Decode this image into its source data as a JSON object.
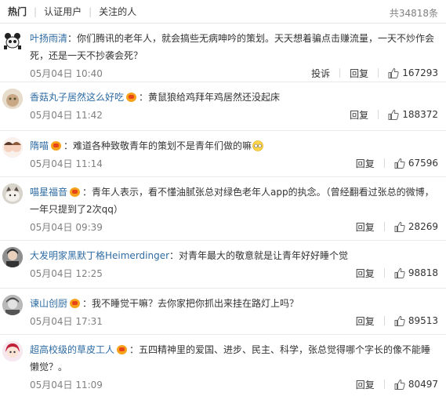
{
  "tabs": {
    "hot": "热门",
    "verified": "认证用户",
    "following": "关注的人",
    "total": "共34818条"
  },
  "comments": [
    {
      "user": "叶扬雨清",
      "vip": false,
      "text": "：你们腾讯的老年人，就会搞些无病呻吟的策划。天天想着骗点击赚流量，一天不炒作会死，还是一天不抄袭会死？",
      "time": "05月04日 10:40",
      "report": "投诉",
      "reply": "回复",
      "likes": "167293"
    },
    {
      "user": "香菇丸子居然这么好吃",
      "vip": true,
      "text": "：黄鼠狼给鸡拜年鸡居然还没起床",
      "time": "05月04日 11:42",
      "reply": "回复",
      "likes": "188372"
    },
    {
      "user": "隋喵",
      "vip": true,
      "text": "：难道各种致敬青年的策划不是青年们做的嘛",
      "time": "05月04日 11:14",
      "reply": "回复",
      "likes": "67596"
    },
    {
      "user": "喵星福音",
      "vip": true,
      "text": "：青年人表示，看不懂油腻张总对绿色老年人app的执念。（曾经翻看过张总的微博，一年只提到了2次qq）",
      "time": "05月04日 09:39",
      "reply": "回复",
      "likes": "28269"
    },
    {
      "user": "大发明家黑默丁格Heimerdinger",
      "vip": false,
      "text": "：对青年最大的敬意就是让青年好好睡个觉",
      "time": "05月04日 12:25",
      "reply": "回复",
      "likes": "98818"
    },
    {
      "user": "谏山创厨",
      "vip": true,
      "text": "：我不睡觉干嘛？去你家把你抓出来挂在路灯上吗？",
      "time": "05月04日 17:31",
      "reply": "回复",
      "likes": "89513"
    },
    {
      "user": "超高校级的草皮工人",
      "vip": true,
      "text": "：五四精神里的爱国、进步、民主、科学，张总觉得哪个字长的像不能睡懒觉？。",
      "time": "05月04日 11:09",
      "reply": "回复",
      "likes": "80497"
    }
  ]
}
